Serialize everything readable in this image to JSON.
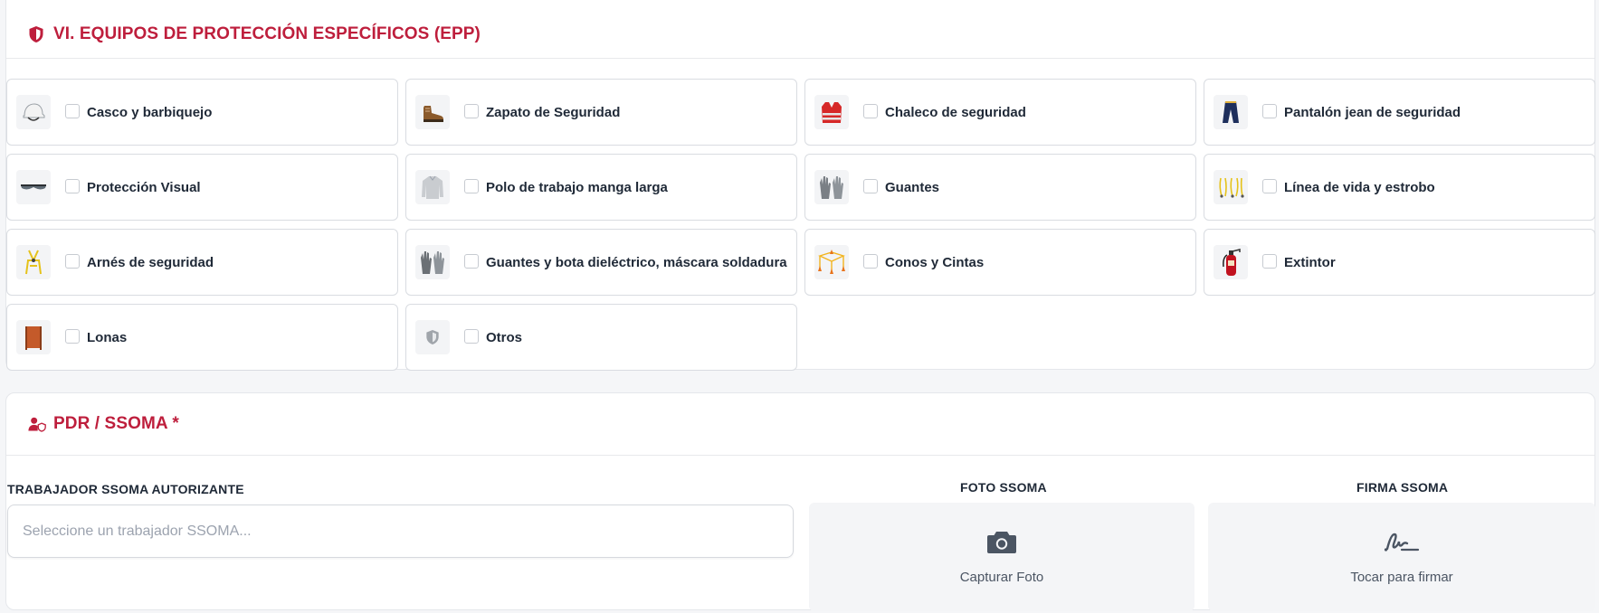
{
  "epp_section": {
    "title": "VI. EQUIPOS DE PROTECCIÓN ESPECÍFICOS (EPP)",
    "items": [
      {
        "label": "Casco y barbiquejo",
        "icon": "helmet-icon",
        "checked": false
      },
      {
        "label": "Zapato de Seguridad",
        "icon": "safety-shoe-icon",
        "checked": false
      },
      {
        "label": "Chaleco de seguridad",
        "icon": "vest-icon",
        "checked": false
      },
      {
        "label": "Pantalón jean de seguridad",
        "icon": "pants-icon",
        "checked": false
      },
      {
        "label": "Protección Visual",
        "icon": "goggles-icon",
        "checked": false
      },
      {
        "label": "Polo de trabajo manga larga",
        "icon": "shirt-icon",
        "checked": false
      },
      {
        "label": "Guantes",
        "icon": "gloves-icon",
        "checked": false
      },
      {
        "label": "Línea de vida y estrobo",
        "icon": "lifeline-icon",
        "checked": false
      },
      {
        "label": "Arnés de seguridad",
        "icon": "harness-icon",
        "checked": false
      },
      {
        "label": "Guantes y bota dieléctrico, máscara soldadura",
        "icon": "dielectric-gloves-icon",
        "checked": false
      },
      {
        "label": "Conos y Cintas",
        "icon": "cones-icon",
        "checked": false
      },
      {
        "label": "Extintor",
        "icon": "extinguisher-icon",
        "checked": false
      },
      {
        "label": "Lonas",
        "icon": "tarp-icon",
        "checked": false
      },
      {
        "label": "Otros",
        "icon": "shield-icon",
        "checked": false
      }
    ]
  },
  "pdr_section": {
    "title": "PDR / SSOMA",
    "required_mark": "*",
    "worker_label": "TRABAJADOR SSOMA AUTORIZANTE",
    "worker_placeholder": "Seleccione un trabajador SSOMA...",
    "photo_label": "FOTO SSOMA",
    "photo_action": "Capturar Foto",
    "sign_label": "FIRMA SSOMA",
    "sign_action": "Tocar para firmar"
  },
  "colors": {
    "accent": "#be1e3c",
    "border": "#d9dce1",
    "muted": "#9ca3af"
  }
}
